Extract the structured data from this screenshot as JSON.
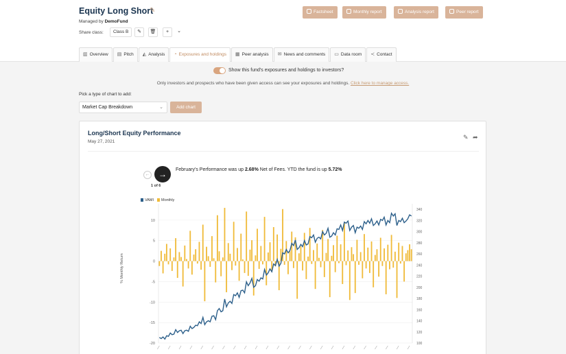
{
  "header": {
    "title": "Equity Long Short",
    "managed_prefix": "Managed by",
    "manager": "DemoFund",
    "share_class_label": "Share class:",
    "share_class_value": "Class B",
    "buttons": [
      "Factsheet",
      "Monthly report",
      "Analysis report",
      "Peer report"
    ]
  },
  "tabs": [
    {
      "label": "Overview",
      "icon": "chart-icon"
    },
    {
      "label": "Pitch",
      "icon": "presentation-icon"
    },
    {
      "label": "Analysis",
      "icon": "analysis-icon"
    },
    {
      "label": "Exposures and holdings",
      "icon": "pie-icon",
      "active": true
    },
    {
      "label": "Peer analysis",
      "icon": "bar-icon"
    },
    {
      "label": "News and comments",
      "icon": "news-icon"
    },
    {
      "label": "Data room",
      "icon": "folder-icon"
    },
    {
      "label": "Contact",
      "icon": "share-icon"
    }
  ],
  "exposure": {
    "toggle_label": "Show this fund's exposures and holdings to investors?",
    "toggle_on": true,
    "info_text": "Only investors and prospects who have been given access can see your exposures and holdings.",
    "info_link": "Click here to manage access."
  },
  "chart_picker": {
    "label": "Pick a type of chart to add:",
    "selected": "Market Cap Breakdown",
    "add_button": "Add chart"
  },
  "card": {
    "title": "Long/Short Equity Performance",
    "date": "May 27, 2021",
    "slide_count": "1 of 6",
    "perf_prefix": "February's Performance was up",
    "perf_month_value": "2.68%",
    "perf_middle": "Net of Fees. YTD the fund is up",
    "perf_ytd_value": "5.72%"
  },
  "chart_data": {
    "type": "bar",
    "series": [
      {
        "name": "VAMI",
        "color": "#2c5f8a"
      },
      {
        "name": "Monthly",
        "color": "#f0bb3a"
      }
    ],
    "ylabel": "% Monthly Return",
    "yticks_left": [
      "10",
      "5",
      "0",
      "-5",
      "-10",
      "-15",
      "-20"
    ],
    "yticks_right": [
      "340",
      "320",
      "300",
      "280",
      "260",
      "240",
      "220",
      "200",
      "180",
      "160",
      "140",
      "120",
      "100"
    ],
    "ylim_left": [
      -20,
      14
    ],
    "ylim_right": [
      100,
      350
    ],
    "monthly_values": [
      -1.2,
      2.5,
      -3.0,
      1.8,
      4.2,
      -0.8,
      3.1,
      -2.4,
      0.9,
      5.6,
      -4.1,
      2.2,
      1.0,
      -6.2,
      3.8,
      0.5,
      -1.8,
      7.4,
      -3.3,
      1.6,
      2.9,
      -0.6,
      4.7,
      -2.1,
      8.9,
      -9.8,
      3.5,
      1.2,
      -1.4,
      6.1,
      0.7,
      -5.2,
      11.2,
      2.4,
      -3.7,
      0.9,
      13.0,
      -7.6,
      4.4,
      1.8,
      -2.2,
      9.6,
      -1.1,
      3.2,
      -4.8,
      6.7,
      0.4,
      -2.9,
      12.1,
      -3.6,
      2.8,
      5.1,
      -8.4,
      1.4,
      7.9,
      -1.9,
      3.7,
      -0.8,
      10.8,
      -5.9,
      2.1,
      4.6,
      -2.6,
      8.3,
      -1.3,
      6.5,
      -7.1,
      3.0,
      12.7,
      -0.9,
      4.9,
      -3.2,
      2.4,
      7.2,
      -1.7,
      5.8,
      -9.2,
      1.9,
      3.6,
      -2.3,
      6.9,
      -4.4,
      1.1,
      8.1,
      -0.7,
      2.7,
      -6.8,
      4.3,
      0.8,
      -1.5,
      7.6,
      -3.9,
      2.0,
      5.4,
      -8.8,
      1.3,
      3.9,
      -2.7,
      6.2,
      -0.5,
      4.1,
      -5.6,
      9.3,
      -1.0,
      2.6,
      -9.5,
      3.4,
      1.7,
      -7.8,
      5.2,
      -0.9,
      2.2,
      -4.2,
      6.6,
      -1.8,
      3.3,
      -2.9,
      4.8,
      -6.4,
      1.5,
      2.9,
      -3.8,
      5.7,
      -1.2,
      3.1,
      -8.1,
      4.0,
      -2.0,
      6.4,
      -1.6,
      2.3,
      -9.0,
      4.5,
      -0.6,
      3.7,
      -5.0,
      1.9,
      2.68,
      4.1,
      2.9
    ],
    "vami_values": [
      110,
      108,
      111,
      107,
      113,
      112,
      118,
      115,
      116,
      124,
      119,
      122,
      123,
      117,
      122,
      123,
      121,
      130,
      126,
      128,
      132,
      131,
      138,
      135,
      146,
      133,
      138,
      140,
      138,
      148,
      149,
      142,
      158,
      162,
      156,
      158,
      179,
      165,
      172,
      175,
      171,
      187,
      185,
      190,
      182,
      194,
      195,
      190,
      210,
      203,
      208,
      216,
      200,
      203,
      214,
      211,
      217,
      215,
      232,
      222,
      226,
      233,
      228,
      242,
      239,
      250,
      238,
      243,
      262,
      260,
      268,
      262,
      266,
      279,
      275,
      285,
      268,
      271,
      277,
      273,
      284,
      276,
      278,
      291,
      289,
      294,
      281,
      288,
      290,
      287,
      300,
      294,
      297,
      306,
      290,
      292,
      298,
      294,
      305,
      304,
      312,
      302,
      317,
      315,
      319,
      302,
      308,
      311,
      298,
      308,
      306,
      310,
      304,
      318,
      314,
      320,
      315,
      323,
      311,
      314,
      319,
      312,
      322,
      320,
      326,
      312,
      320,
      316,
      333,
      328,
      332,
      311,
      320,
      318,
      324,
      316,
      319,
      323,
      330,
      328
    ]
  }
}
